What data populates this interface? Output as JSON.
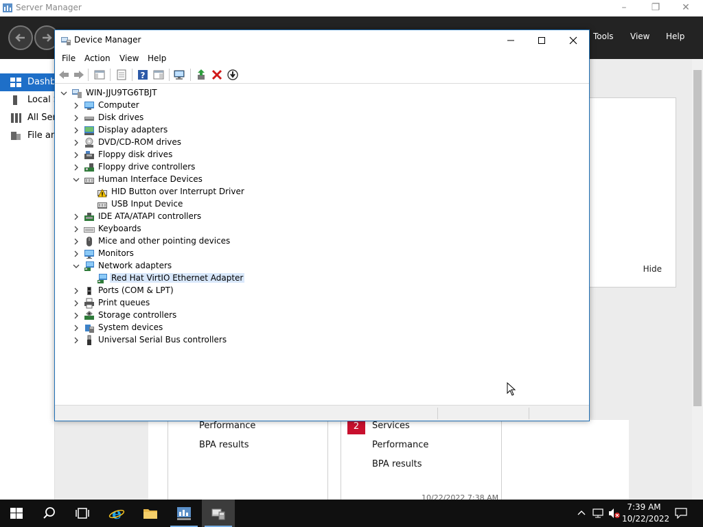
{
  "server_manager": {
    "title": "Server Manager",
    "menu": [
      "Tools",
      "View",
      "Help"
    ],
    "sidebar": [
      {
        "label": "Dashboard",
        "active": true
      },
      {
        "label": "Local Server",
        "active": false
      },
      {
        "label": "All Servers",
        "active": false
      },
      {
        "label": "File and Storage Services",
        "active": false
      }
    ],
    "hide_label": "Hide",
    "tile_left": [
      "Performance",
      "BPA results"
    ],
    "tile_right": {
      "badge": "2",
      "lines": [
        "Services",
        "Performance",
        "BPA results"
      ]
    },
    "tile_timestamp": "10/22/2022 7:38 AM"
  },
  "device_manager": {
    "title": "Device Manager",
    "menu": [
      "File",
      "Action",
      "View",
      "Help"
    ],
    "root": "WIN-JJU9TG6TBJT",
    "tree": [
      {
        "label": "Computer",
        "icon": "computer-icon",
        "level": 1,
        "expanded": false
      },
      {
        "label": "Disk drives",
        "icon": "disk-drive-icon",
        "level": 1,
        "expanded": false
      },
      {
        "label": "Display adapters",
        "icon": "display-adapter-icon",
        "level": 1,
        "expanded": false
      },
      {
        "label": "DVD/CD-ROM drives",
        "icon": "dvd-drive-icon",
        "level": 1,
        "expanded": false
      },
      {
        "label": "Floppy disk drives",
        "icon": "floppy-disk-icon",
        "level": 1,
        "expanded": false
      },
      {
        "label": "Floppy drive controllers",
        "icon": "floppy-controller-icon",
        "level": 1,
        "expanded": false
      },
      {
        "label": "Human Interface Devices",
        "icon": "hid-icon",
        "level": 1,
        "expanded": true
      },
      {
        "label": "HID Button over Interrupt Driver",
        "icon": "hid-warning-icon",
        "level": 2
      },
      {
        "label": "USB Input Device",
        "icon": "hid-icon",
        "level": 2
      },
      {
        "label": "IDE ATA/ATAPI controllers",
        "icon": "ide-controller-icon",
        "level": 1,
        "expanded": false
      },
      {
        "label": "Keyboards",
        "icon": "keyboard-icon",
        "level": 1,
        "expanded": false
      },
      {
        "label": "Mice and other pointing devices",
        "icon": "mouse-icon",
        "level": 1,
        "expanded": false
      },
      {
        "label": "Monitors",
        "icon": "monitor-icon",
        "level": 1,
        "expanded": false
      },
      {
        "label": "Network adapters",
        "icon": "network-adapter-icon",
        "level": 1,
        "expanded": true
      },
      {
        "label": "Red Hat VirtIO Ethernet Adapter",
        "icon": "network-adapter-icon",
        "level": 2,
        "selected": true
      },
      {
        "label": "Ports (COM & LPT)",
        "icon": "port-icon",
        "level": 1,
        "expanded": false
      },
      {
        "label": "Print queues",
        "icon": "printer-icon",
        "level": 1,
        "expanded": false
      },
      {
        "label": "Storage controllers",
        "icon": "storage-controller-icon",
        "level": 1,
        "expanded": false
      },
      {
        "label": "System devices",
        "icon": "system-device-icon",
        "level": 1,
        "expanded": false
      },
      {
        "label": "Universal Serial Bus controllers",
        "icon": "usb-icon",
        "level": 1,
        "expanded": false
      }
    ]
  },
  "taskbar": {
    "time": "7:39 AM",
    "date": "10/22/2022"
  },
  "colors": {
    "accent": "#1e6fc8",
    "header_dark": "#232323",
    "badge_red": "#c8102e",
    "selection": "#d9e8fb"
  }
}
